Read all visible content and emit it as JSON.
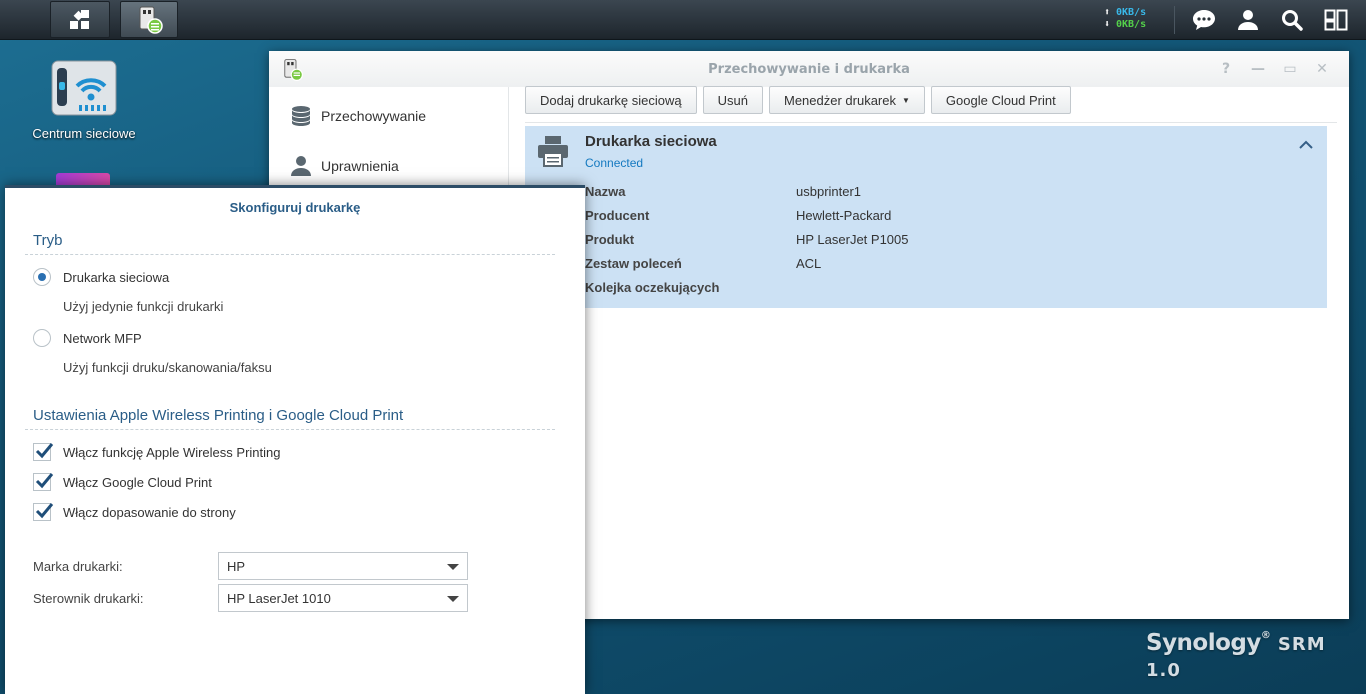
{
  "taskbar": {
    "speed_up": "0KB/s",
    "speed_down": "0KB/s",
    "icons": [
      "show-desktop-icon",
      "storage-printer-app-icon",
      "messages-icon",
      "user-icon",
      "search-icon",
      "widgets-icon"
    ]
  },
  "desktop": {
    "icons": [
      {
        "label": "Centrum sieciowe",
        "icon": "wifi-router-icon"
      }
    ]
  },
  "window": {
    "title": "Przechowywanie i drukarka",
    "controls": [
      "help-icon",
      "minimize-icon",
      "maximize-icon",
      "close-icon"
    ],
    "sidebar": [
      {
        "label": "Przechowywanie",
        "icon": "database-icon"
      },
      {
        "label": "Uprawnienia",
        "icon": "user-icon"
      }
    ],
    "toolbar": {
      "add_label": "Dodaj drukarkę sieciową",
      "remove_label": "Usuń",
      "manager_label": "Menedżer drukarek",
      "cloud_label": "Google Cloud Print"
    },
    "printer": {
      "name": "Drukarka sieciowa",
      "status": "Connected",
      "details": [
        {
          "key": "Nazwa",
          "value": "usbprinter1"
        },
        {
          "key": "Producent",
          "value": "Hewlett-Packard"
        },
        {
          "key": "Produkt",
          "value": "HP LaserJet P1005"
        },
        {
          "key": "Zestaw poleceń",
          "value": "ACL"
        },
        {
          "key": "Kolejka oczekujących",
          "value": ""
        }
      ]
    }
  },
  "dialog": {
    "title": "Skonfiguruj drukarkę",
    "mode_section": "Tryb",
    "mode_options": [
      {
        "label": "Drukarka sieciowa",
        "desc": "Użyj jedynie funkcji drukarki",
        "selected": true
      },
      {
        "label": "Network MFP",
        "desc": "Użyj funkcji druku/skanowania/faksu",
        "selected": false
      }
    ],
    "apple_section": "Ustawienia Apple Wireless Printing i Google Cloud Print",
    "checks": [
      {
        "label": "Włącz funkcję Apple Wireless Printing",
        "checked": true
      },
      {
        "label": "Włącz Google Cloud Print",
        "checked": true
      },
      {
        "label": "Włącz dopasowanie do strony",
        "checked": true
      }
    ],
    "brand_label": "Marka drukarki:",
    "brand_value": "HP",
    "driver_label": "Sterownik drukarki:",
    "driver_value": "HP LaserJet 1010"
  },
  "branding": {
    "name": "Synology",
    "product": "SRM 1.0"
  },
  "colors": {
    "accent": "#2a5d87",
    "selection": "#cce1f4",
    "status": "#1479c0"
  }
}
